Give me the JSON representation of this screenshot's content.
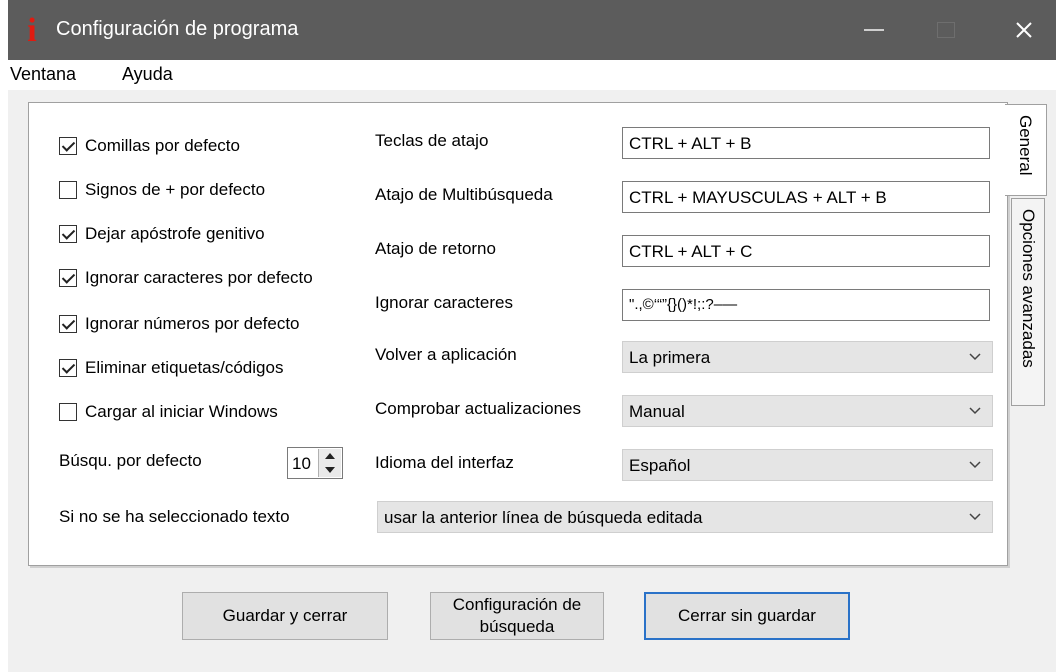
{
  "window": {
    "title": "Configuración de programa",
    "app_icon_glyph": "i",
    "app_icon_color": "#e01b10",
    "titlebar_color": "#5c5c5c"
  },
  "menu": {
    "items": [
      "Ventana",
      "Ayuda"
    ]
  },
  "tabs": {
    "general": "General",
    "advanced": "Opciones avanzadas",
    "active": "General"
  },
  "checkboxes": [
    {
      "label": "Comillas por defecto",
      "checked": true
    },
    {
      "label": "Signos de + por defecto",
      "checked": false
    },
    {
      "label": "Dejar apóstrofe genitivo",
      "checked": true
    },
    {
      "label": "Ignorar caracteres por defecto",
      "checked": true
    },
    {
      "label": "Ignorar números por defecto",
      "checked": true
    },
    {
      "label": "Eliminar etiquetas/códigos",
      "checked": true
    },
    {
      "label": "Cargar al iniciar Windows",
      "checked": false
    }
  ],
  "default_search": {
    "label": "Búsqu. por defecto",
    "value": "10"
  },
  "no_selection": {
    "label": "Si no se ha seleccionado texto",
    "value": "usar la anterior línea de búsqueda editada"
  },
  "fields": {
    "hotkey": {
      "label": "Teclas de atajo",
      "value": "CTRL + ALT + B"
    },
    "multi_hotkey": {
      "label": "Atajo de Multibúsqueda",
      "value": "CTRL + MAYUSCULAS + ALT + B"
    },
    "return_hotkey": {
      "label": "Atajo de retorno",
      "value": "CTRL + ALT + C"
    },
    "ignore_chars": {
      "label": "Ignorar caracteres",
      "value": "\".,©‘“”{}()*!;:?–—"
    }
  },
  "combos": {
    "return_app": {
      "label": "Volver a aplicación",
      "value": "La primera"
    },
    "check_updates": {
      "label": "Comprobar actualizaciones",
      "value": "Manual"
    },
    "ui_language": {
      "label": "Idioma del interfaz",
      "value": "Español"
    }
  },
  "buttons": {
    "save_close": "Guardar y cerrar",
    "search_config_line1": "Configuración de",
    "search_config_line2": "búsqueda",
    "close_no_save": "Cerrar sin guardar"
  },
  "colors": {
    "default_button_border": "#2a72c8",
    "window_bg": "#f0f0f0"
  }
}
